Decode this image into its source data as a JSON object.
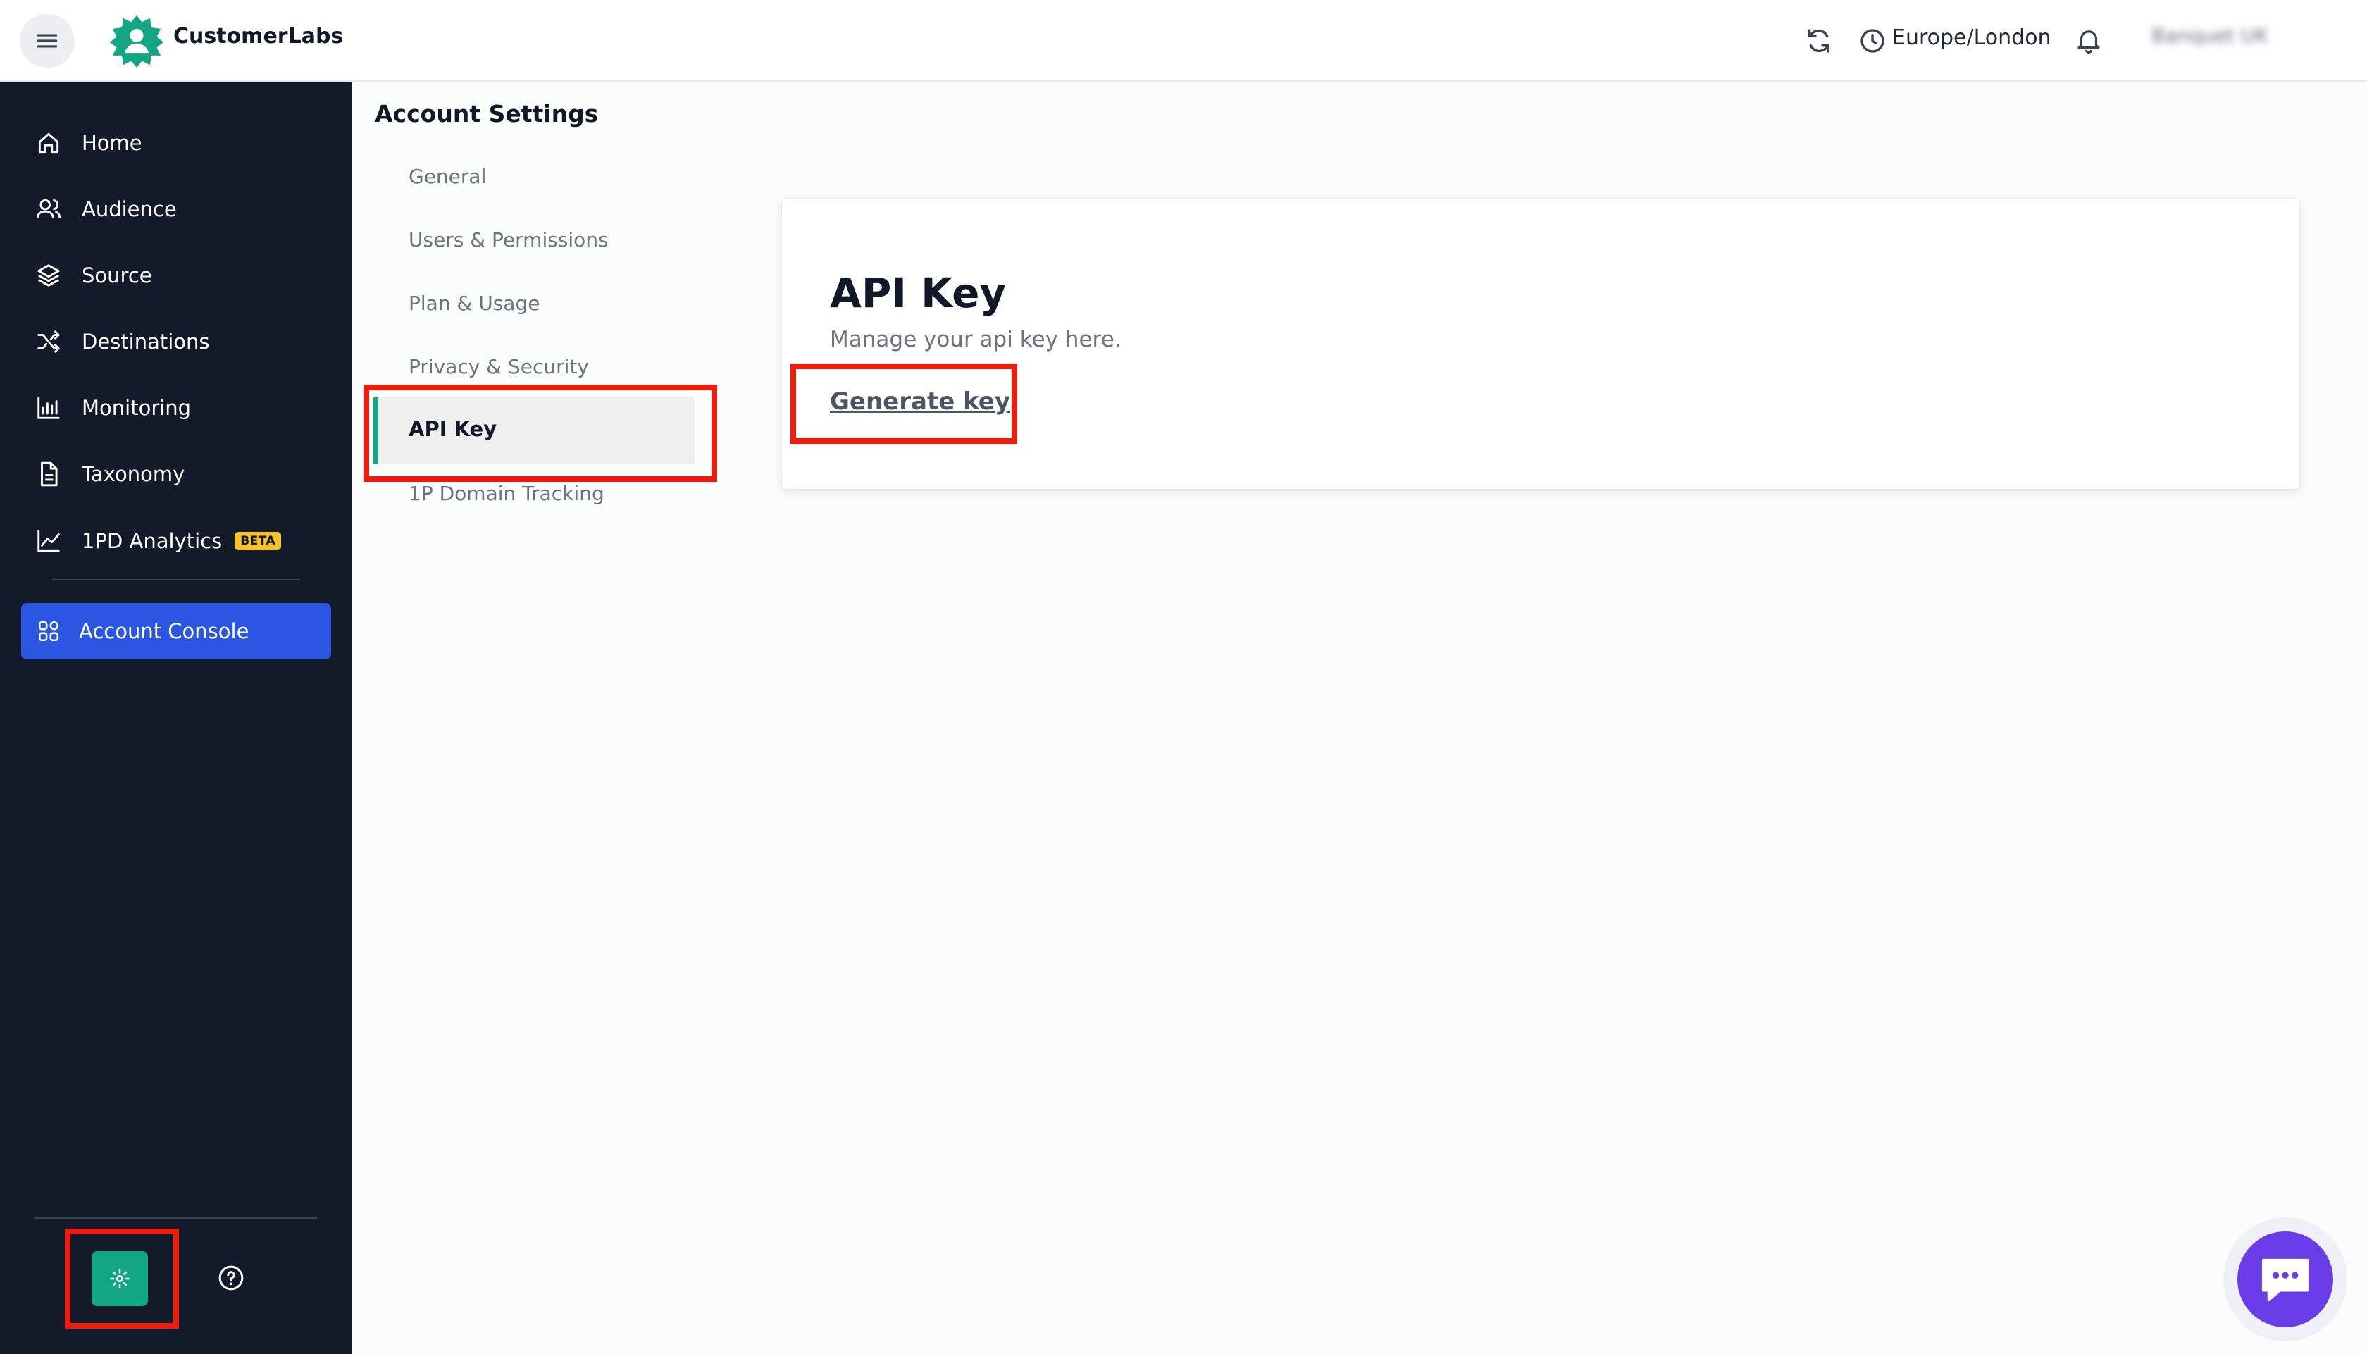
{
  "app": {
    "brand": "CustomerLabs",
    "timezone": "Europe/London",
    "user_menu": "Banquet UK"
  },
  "sidebar": {
    "items": [
      {
        "label": "Home",
        "icon": "home-icon"
      },
      {
        "label": "Audience",
        "icon": "users-icon"
      },
      {
        "label": "Source",
        "icon": "layers-icon"
      },
      {
        "label": "Destinations",
        "icon": "shuffle-icon"
      },
      {
        "label": "Monitoring",
        "icon": "bar-chart-icon"
      },
      {
        "label": "Taxonomy",
        "icon": "document-icon"
      },
      {
        "label": "1PD Analytics",
        "icon": "trend-icon",
        "badge": "BETA"
      }
    ],
    "active": {
      "label": "Account Console",
      "icon": "grid-icon"
    }
  },
  "settings": {
    "title": "Account Settings",
    "items": [
      "General",
      "Users & Permissions",
      "Plan & Usage",
      "Privacy & Security",
      "API Key",
      "1P Domain Tracking"
    ]
  },
  "card": {
    "title": "API Key",
    "subtitle": "Manage your api key here.",
    "link": "Generate key"
  },
  "colors": {
    "sidebar_bg": "#131a2a",
    "accent_blue": "#2a56e2",
    "accent_green": "#12a682",
    "highlight_red": "#ee1c0d",
    "chat_purple": "#6a3de8",
    "beta_yellow": "#f6c328"
  }
}
